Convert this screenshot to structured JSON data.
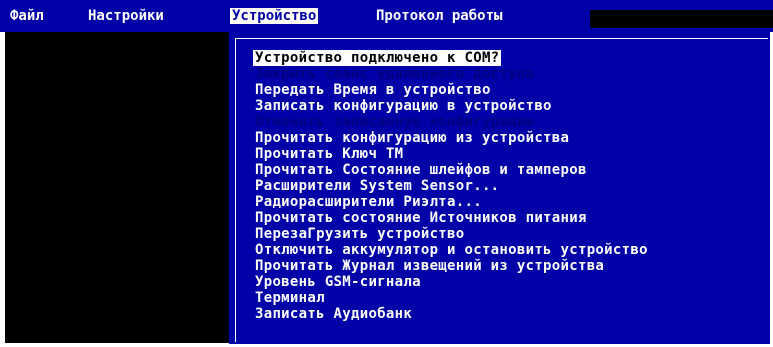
{
  "menubar": {
    "items": [
      {
        "label": "Файл"
      },
      {
        "label": "Настройки"
      },
      {
        "label": "Устройство"
      },
      {
        "label": "Протокол работы"
      }
    ]
  },
  "dropdown": {
    "selected_index": 0,
    "items": [
      {
        "label": "Устройство подключено к COM?",
        "enabled": true
      },
      {
        "label": "Закрыть сеанс удаленного доступа",
        "enabled": false
      },
      {
        "label": "Передать Время в устройство",
        "enabled": true
      },
      {
        "label": "Записать конфигурацию в устройство",
        "enabled": true
      },
      {
        "label": "Отменить записанную конфигурацию",
        "enabled": false
      },
      {
        "label": "Прочитать конфигурацию из устройства",
        "enabled": true
      },
      {
        "label": "Прочитать Ключ ТМ",
        "enabled": true
      },
      {
        "label": "Прочитать Состояние шлейфов и тамперов",
        "enabled": true
      },
      {
        "label": "Расширители System Sensor...",
        "enabled": true
      },
      {
        "label": "Радиорасширители Риэлта...",
        "enabled": true
      },
      {
        "label": "Прочитать состояние Источников питания",
        "enabled": true
      },
      {
        "label": "ПерезаГрузить устройство",
        "enabled": true
      },
      {
        "label": "Отключить аккумулятор и остановить устройство",
        "enabled": true
      },
      {
        "label": "Прочитать Журнал извещений из устройства",
        "enabled": true
      },
      {
        "label": "Уровень GSM-сигнала",
        "enabled": true
      },
      {
        "label": "Терминал",
        "enabled": true
      },
      {
        "label": "Записать Аудиобанк",
        "enabled": true
      }
    ]
  },
  "colors": {
    "menubar_bg": "#0000a8",
    "dropdown_bg": "#0000a8",
    "disabled_text": "#000080",
    "selected_bg": "#ffffff"
  }
}
